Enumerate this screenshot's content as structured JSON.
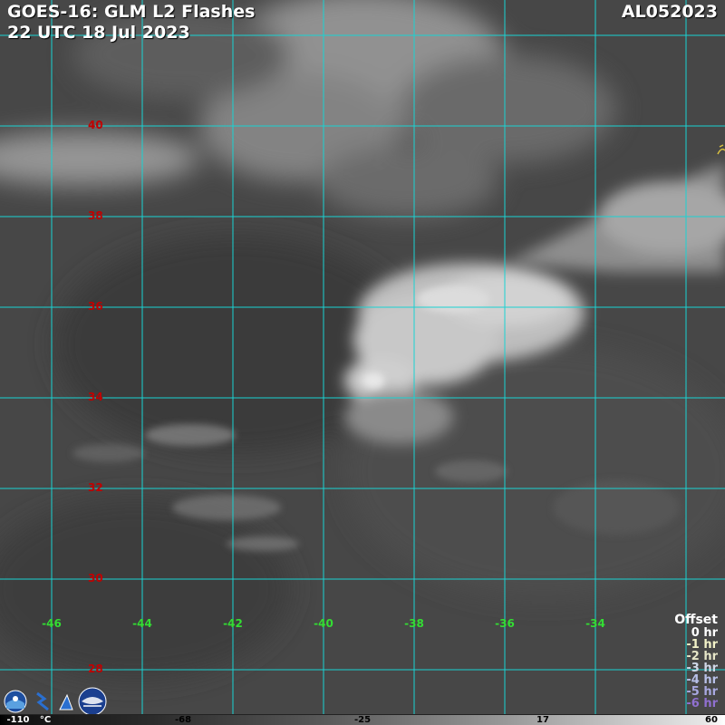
{
  "header": {
    "title": "GOES-16: GLM L2 Flashes",
    "datetime": "22 UTC 18 Jul 2023",
    "storm_id": "AL052023"
  },
  "latitude_labels": [
    "40",
    "38",
    "36",
    "34",
    "32",
    "30",
    "28"
  ],
  "longitude_labels": [
    "-46",
    "-44",
    "-42",
    "-40",
    "-38",
    "-36",
    "-34"
  ],
  "legend": {
    "heading": "Offset",
    "items": [
      {
        "label": "0 hr",
        "color": "#ffffff"
      },
      {
        "label": "-1 hr",
        "color": "#f2f2c8"
      },
      {
        "label": "-2 hr",
        "color": "#e6e6c8"
      },
      {
        "label": "-3 hr",
        "color": "#d0d8e8"
      },
      {
        "label": "-4 hr",
        "color": "#b8c0e8"
      },
      {
        "label": "-5 hr",
        "color": "#a8a8e0"
      },
      {
        "label": "-6 hr",
        "color": "#9070d0"
      }
    ]
  },
  "colorbar": {
    "labels": [
      "-110",
      "°C",
      "-68",
      "-25",
      "17",
      "60"
    ]
  },
  "colors": {
    "grid": "#19d3d3",
    "lat_label": "#c00000",
    "lon_label": "#33dd33"
  },
  "icons": [
    "noaa-logo-icon",
    "nesdis-logo-icon",
    "cira-logo-icon",
    "rammb-logo-icon"
  ]
}
